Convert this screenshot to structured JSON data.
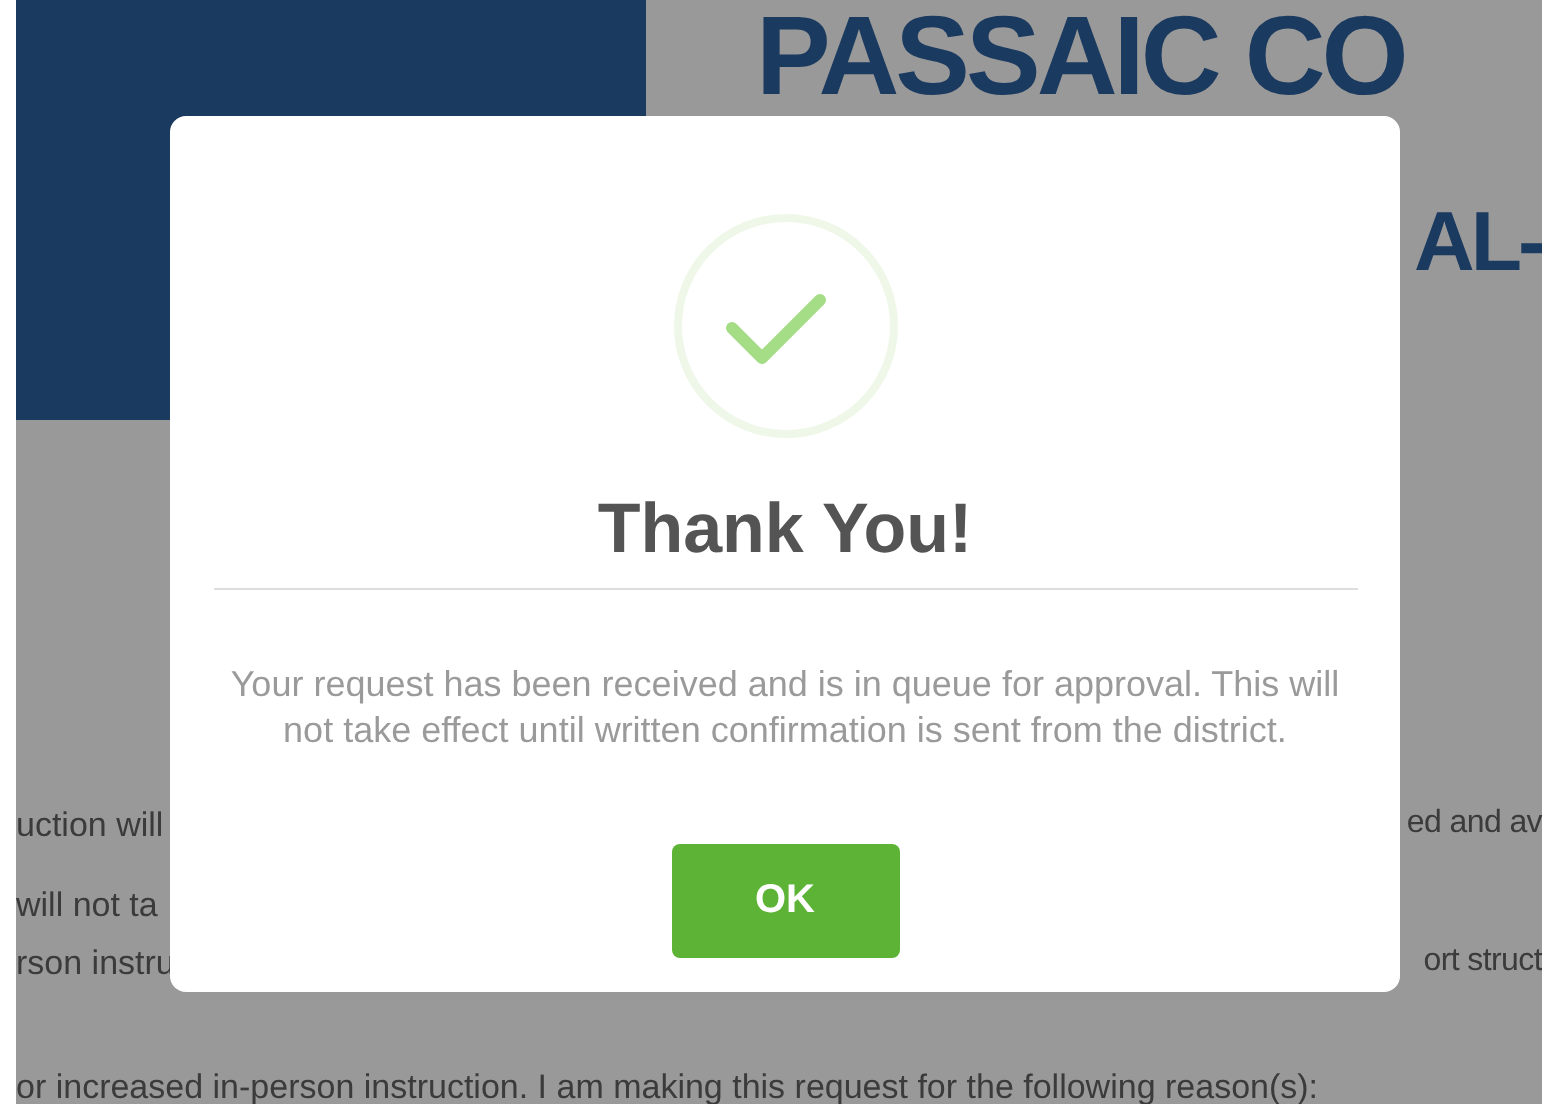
{
  "background_page": {
    "heading_line_1": "PASSAIC CO",
    "heading_line_2_visible": "AL-",
    "text_rows": [
      {
        "left": "uction will",
        "right": "ed and av"
      },
      {
        "left": "will not ta"
      },
      {
        "left": "rson instru",
        "right": "ort struct"
      },
      {
        "left": "or increased in-person instruction. I am making this request for the following reason(s):"
      }
    ]
  },
  "dialog": {
    "kind": "success",
    "title": "Thank You!",
    "message": "Your request has been received and is in queue for approval. This will not take effect until written confirmation is sent from the district.",
    "buttons": [
      "OK"
    ]
  }
}
